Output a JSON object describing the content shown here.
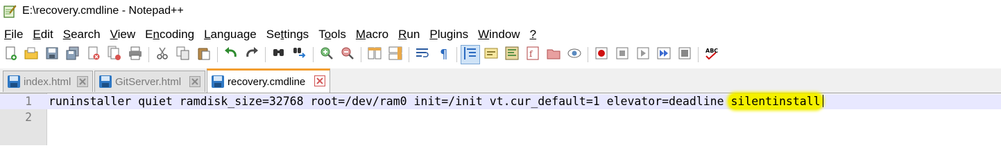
{
  "window": {
    "title": "E:\\recovery.cmdline - Notepad++",
    "app_icon": "notepadpp-icon"
  },
  "menu": [
    {
      "pre": "",
      "ul": "F",
      "post": "ile"
    },
    {
      "pre": "",
      "ul": "E",
      "post": "dit"
    },
    {
      "pre": "",
      "ul": "S",
      "post": "earch"
    },
    {
      "pre": "",
      "ul": "V",
      "post": "iew"
    },
    {
      "pre": "E",
      "ul": "n",
      "post": "coding"
    },
    {
      "pre": "",
      "ul": "L",
      "post": "anguage"
    },
    {
      "pre": "Se",
      "ul": "t",
      "post": "tings"
    },
    {
      "pre": "T",
      "ul": "o",
      "post": "ols"
    },
    {
      "pre": "",
      "ul": "M",
      "post": "acro"
    },
    {
      "pre": "",
      "ul": "R",
      "post": "un"
    },
    {
      "pre": "",
      "ul": "P",
      "post": "lugins"
    },
    {
      "pre": "",
      "ul": "W",
      "post": "indow"
    },
    {
      "pre": "",
      "ul": "?",
      "post": ""
    }
  ],
  "toolbar": [
    "new-file-icon",
    "open-file-icon",
    "save-icon",
    "save-all-icon",
    "close-icon",
    "close-all-icon",
    "print-icon",
    "|",
    "cut-icon",
    "copy-icon",
    "paste-icon",
    "|",
    "undo-icon",
    "redo-icon",
    "|",
    "find-icon",
    "replace-icon",
    "|",
    "zoom-in-icon",
    "zoom-out-icon",
    "|",
    "sync-vertical-icon",
    "sync-horizontal-icon",
    "|",
    "word-wrap-icon",
    "show-all-chars-icon",
    "|",
    "indent-guide-icon",
    "user-language-icon",
    "document-map-icon",
    "function-list-icon",
    "folder-as-workspace-icon",
    "monitoring-icon",
    "|",
    "record-macro-icon",
    "stop-recording-icon",
    "playback-icon",
    "run-multiple-icon",
    "save-macro-icon",
    "|",
    "spellcheck-icon"
  ],
  "tabs": [
    {
      "label": "index.html",
      "state": "saved",
      "active": false
    },
    {
      "label": "GitServer.html",
      "state": "saved",
      "active": false
    },
    {
      "label": "recovery.cmdline",
      "state": "saved",
      "active": true
    }
  ],
  "editor": {
    "lines": [
      {
        "number": "1",
        "text": "runinstaller quiet ramdisk_size=32768 root=/dev/ram0 init=/init vt.cur_default=1 elevator=deadline ",
        "highlight": "silentinstall"
      },
      {
        "number": "2",
        "text": ""
      }
    ],
    "highlight_color": "#f4f000"
  },
  "colors": {
    "active_tab_accent": "#f29d30",
    "tab_close": "#d35a5a",
    "current_line": "#e8e8ff"
  }
}
